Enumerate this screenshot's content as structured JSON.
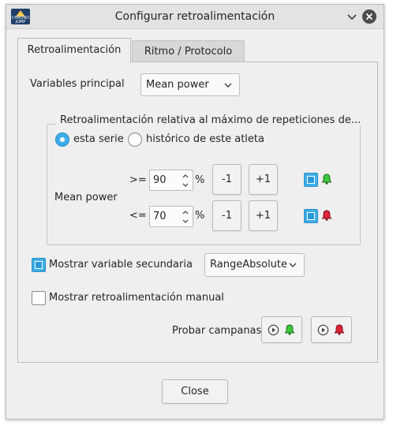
{
  "window": {
    "title": "Configurar retroalimentación",
    "app_icon_text": "CHRONO JUMP"
  },
  "tabs": [
    {
      "label": "Retroalimentación",
      "active": true
    },
    {
      "label": "Ritmo / Protocolo",
      "active": false
    }
  ],
  "main_variable": {
    "label": "Variables principal",
    "value": "Mean power"
  },
  "relative_group": {
    "title": "Retroalimentación relativa al máximo de repeticiones de...",
    "options": [
      {
        "label": "esta serie",
        "selected": true
      },
      {
        "label": "histórico de este atleta",
        "selected": false
      }
    ],
    "variable_label": "Mean power",
    "rows": [
      {
        "operator": ">=",
        "value": "90",
        "unit": "%",
        "minus": "-1",
        "plus": "+1",
        "enabled": true,
        "bell_color": "#3cc83c",
        "bell_icon": "bell-green-icon"
      },
      {
        "operator": "<=",
        "value": "70",
        "unit": "%",
        "minus": "-1",
        "plus": "+1",
        "enabled": true,
        "bell_color": "#e0233a",
        "bell_icon": "bell-red-icon"
      }
    ]
  },
  "secondary": {
    "label": "Mostrar variable secundaria",
    "checked": true,
    "value": "RangeAbsolute"
  },
  "manual": {
    "label": "Mostrar retroalimentación manual",
    "checked": false
  },
  "test_bells": {
    "label": "Probar campanas"
  },
  "footer": {
    "close_label": "Close"
  },
  "colors": {
    "accent": "#3daee9",
    "bell_good": "#3cc83c",
    "bell_bad": "#e0233a"
  }
}
